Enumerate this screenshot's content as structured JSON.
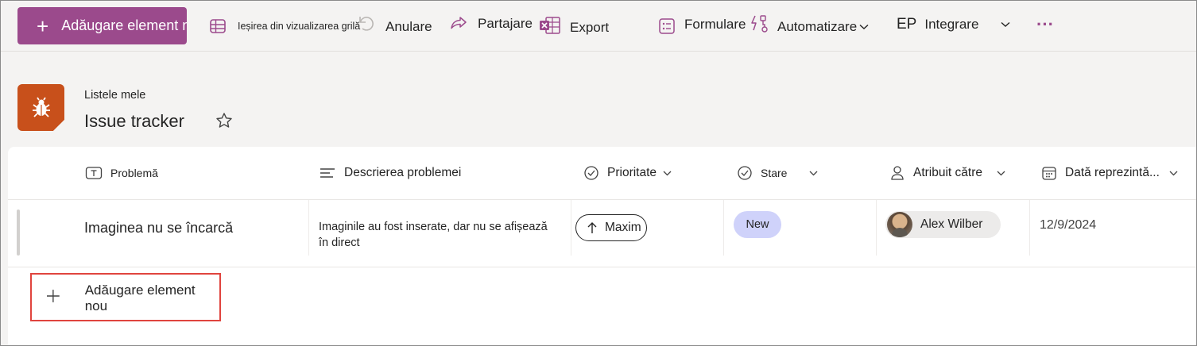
{
  "toolbar": {
    "new_item": "Adăugare element nou",
    "exit_grid": "Ieșirea din vizualizarea grilă",
    "undo": "Anulare",
    "share": "Partajare",
    "export": "Export",
    "forms": "Formulare",
    "automate": "Automatizare",
    "integrate_prefix": "EP",
    "integrate": "Integrare",
    "more": "···"
  },
  "header": {
    "breadcrumb": "Listele mele",
    "title": "Issue tracker",
    "accent_color": "#c8501b"
  },
  "columns": [
    {
      "label": "Problemă",
      "icon": "text-icon"
    },
    {
      "label": "Descrierea problemei",
      "icon": "multiline-text-icon"
    },
    {
      "label": "Prioritate",
      "icon": "choice-icon"
    },
    {
      "label": "Stare",
      "icon": "choice-icon"
    },
    {
      "label": "Atribuit către",
      "icon": "person-icon"
    },
    {
      "label": "Dată reprezintă...",
      "icon": "calendar-icon"
    }
  ],
  "rows": [
    {
      "issue": "Imaginea nu se încarcă",
      "description_line1": "Imaginile au fost inserate, dar nu se afișează",
      "description_line2": "în direct",
      "priority": "Maxim",
      "status": "New",
      "assigned_to": "Alex Wilber",
      "date": "12/9/2024"
    }
  ],
  "add_row": {
    "label": "Adăugare element nou"
  },
  "colors": {
    "primary_button": "#9b4a8c",
    "status_new": "#cfd2fa",
    "highlight_box": "#e0443e"
  }
}
